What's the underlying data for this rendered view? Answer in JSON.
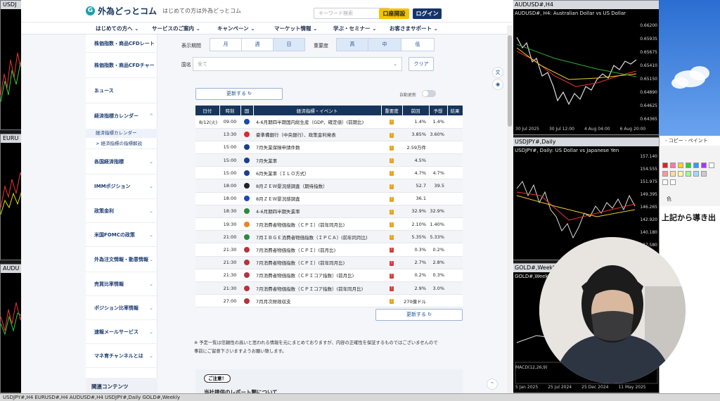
{
  "site": {
    "logo": "外為どっとコム",
    "tagline": "はじめての方は外為どっとコム",
    "search_placeholder": "キーワード検索",
    "open_account": "口座開設",
    "login": "ログイン",
    "brand_color": "#16346a",
    "accent_color": "#f6c200"
  },
  "nav": [
    {
      "label": "はじめての方へ ⌄"
    },
    {
      "label": "サービスのご案内 ⌄"
    },
    {
      "label": "キャンペーン ⌄"
    },
    {
      "label": "マーケット情報 ⌄"
    },
    {
      "label": "学ぶ・セミナー ⌄"
    },
    {
      "label": "お客さまサポート ⌄"
    }
  ],
  "sidebar": {
    "items": [
      {
        "label": "株価指数・商品CFDレート"
      },
      {
        "label": "株価指数・商品CFDチャート"
      },
      {
        "label": "ニュース"
      },
      {
        "label": "経済指標カレンダー",
        "chev": "^"
      },
      {
        "label": "各国経済指標",
        "chev": "⌄"
      },
      {
        "label": "IMMポジション",
        "chev": "⌄"
      },
      {
        "label": "政策金利",
        "chev": "⌄"
      },
      {
        "label": "米国FOMCの政策",
        "chev": "⌄"
      },
      {
        "label": "外為注文情報・動意情報",
        "chev": "⌄"
      },
      {
        "label": "売買比率情報",
        "chev": "⌄"
      },
      {
        "label": "ポジション比率情報",
        "chev": "⌄"
      },
      {
        "label": "速報メールサービス",
        "chev": "⌄"
      },
      {
        "label": "マネ育チャンネルとは",
        "chev": "⌄"
      }
    ],
    "subitems": [
      {
        "label": "経済指標カレンダー"
      },
      {
        "label": "> 経済指標の指標解説"
      }
    ],
    "footer": "関連コンテンツ"
  },
  "filters": {
    "period_label": "表示期間",
    "period_options": [
      "月",
      "週",
      "日"
    ],
    "period_selected": "日",
    "importance_label": "重要度",
    "importance_options": [
      "高",
      "中",
      "低"
    ],
    "country_label": "国名",
    "country_value": "全て",
    "clear": "クリア",
    "refresh": "更新する ↻",
    "auto_update": "自動更新"
  },
  "table": {
    "headers": [
      "日付",
      "時刻",
      "国",
      "経済指標・イベント",
      "重要度",
      "前回",
      "予想",
      "結果"
    ],
    "rows": [
      {
        "date": "8/12(火)",
        "time": "09:00",
        "flag": "#1b4aa8",
        "event": "4-6月期四半期国内総生産（GDP、確定値）(前期比)",
        "imp": "!",
        "imp_level": "mid",
        "prev": "1.4%",
        "fcst": "1.4%",
        "res": ""
      },
      {
        "date": "",
        "time": "13:30",
        "flag": "#d92c2c",
        "event": "豪準備銀行（中央銀行）、政策金利発表",
        "imp": "!",
        "imp_level": "mid",
        "prev": "3.85%",
        "fcst": "3.60%",
        "res": ""
      },
      {
        "date": "",
        "time": "15:00",
        "flag": "#1b3f8e",
        "event": "7月失業保険申請件数",
        "imp": "!",
        "imp_level": "mid",
        "prev": "2.59万件",
        "fcst": "",
        "res": ""
      },
      {
        "date": "",
        "time": "15:00",
        "flag": "#1b3f8e",
        "event": "7月失業率",
        "imp": "!",
        "imp_level": "mid",
        "prev": "4.5%",
        "fcst": "",
        "res": ""
      },
      {
        "date": "",
        "time": "15:00",
        "flag": "#1b3f8e",
        "event": "6月失業率（ＩＬＯ方式）",
        "imp": "!",
        "imp_level": "mid",
        "prev": "4.7%",
        "fcst": "4.7%",
        "res": ""
      },
      {
        "date": "",
        "time": "18:00",
        "flag": "#222222",
        "event": "8月ＺＥＷ景況感調査（期待指数）",
        "imp": "!",
        "imp_level": "mid",
        "prev": "52.7",
        "fcst": "39.5",
        "res": ""
      },
      {
        "date": "",
        "time": "18:00",
        "flag": "#1b4aa8",
        "event": "8月ＺＥＷ景況感調査",
        "imp": "!",
        "imp_level": "mid",
        "prev": "36.1",
        "fcst": "",
        "res": ""
      },
      {
        "date": "",
        "time": "18:30",
        "flag": "#2a8a3e",
        "event": "4-6月期四半期失業率",
        "imp": "!",
        "imp_level": "mid",
        "prev": "32.9%",
        "fcst": "32.9%",
        "res": ""
      },
      {
        "date": "",
        "time": "19:30",
        "flag": "#e8862a",
        "event": "7月消費者物価指数（ＣＰＩ）(前年同月比)",
        "imp": "!",
        "imp_level": "mid",
        "prev": "2.10%",
        "fcst": "1.40%",
        "res": ""
      },
      {
        "date": "",
        "time": "21:00",
        "flag": "#2a8a3e",
        "event": "7月ＩＢＧＥ消費者物価指数（ＩＰＣＡ）(前年同月比)",
        "imp": "!",
        "imp_level": "mid",
        "prev": "5.35%",
        "fcst": "5.33%",
        "res": ""
      },
      {
        "date": "",
        "time": "21:30",
        "flag": "#b5333e",
        "event": "7月消費者物価指数（ＣＰＩ）(前月比)",
        "imp": "!",
        "imp_level": "high",
        "prev": "0.3%",
        "fcst": "0.2%",
        "res": ""
      },
      {
        "date": "",
        "time": "21:30",
        "flag": "#b5333e",
        "event": "7月消費者物価指数（ＣＰＩ）(前年同月比)",
        "imp": "!",
        "imp_level": "high",
        "prev": "2.7%",
        "fcst": "2.8%",
        "res": ""
      },
      {
        "date": "",
        "time": "21:30",
        "flag": "#b5333e",
        "event": "7月消費者物価指数（ＣＰＩコア指数）(前月比)",
        "imp": "!",
        "imp_level": "high",
        "prev": "0.2%",
        "fcst": "0.3%",
        "res": ""
      },
      {
        "date": "",
        "time": "21:30",
        "flag": "#b5333e",
        "event": "7月消費者物価指数（ＣＰＩコア指数）(前年同月比)",
        "imp": "!",
        "imp_level": "high",
        "prev": "2.9%",
        "fcst": "3.0%",
        "res": ""
      },
      {
        "date": "",
        "time": "27:00",
        "flag": "#b5333e",
        "event": "7月月次財政収支",
        "imp": "!",
        "imp_level": "mid",
        "prev": "270億ドル",
        "fcst": "",
        "res": ""
      }
    ]
  },
  "footnote": "※ 予定一覧は信頼性の高いと思われる情報を元にまとめておりますが、内容の正確性を保証するものではございませんので事前にご留意下さいますようお願い致します。",
  "notice": {
    "badge": "ご注意！",
    "title": "当社提供のレポート類について"
  },
  "charts": {
    "audusd": {
      "title": "AUDUSD#,H4",
      "symbol": "AUDUSD#, H4:  Australian Dollar vs US Dollar",
      "prices": [
        "0.66200",
        "0.65935",
        "0.65675",
        "0.65410",
        "0.65150",
        "0.64890",
        "0.64625",
        "0.64365",
        "0.64105"
      ],
      "dates": [
        "30 Jul 2025",
        "30 Jul 12:00",
        "4 Aug 04:00",
        "6 Aug 20:00"
      ]
    },
    "usdjpy": {
      "title": "USDJPY#,Daily",
      "symbol": "USDJPY#, Daily:  US Dollar vs Japanese Yen",
      "prices": [
        "157.140",
        "154.555",
        "151.975",
        "149.395",
        "146.265",
        "142.920",
        "140.180",
        "137.580"
      ]
    },
    "gold": {
      "title": "GOLD#,Weekly",
      "symbol": "GOLD#,Weekly",
      "dates": [
        "5 Jan 2025",
        "25 Jul 2024",
        "25 Dec 2024",
        "11 May 2025"
      ],
      "macd_label": "MACD(12,26,9)"
    }
  },
  "left_windows": [
    {
      "title": "USDJ"
    },
    {
      "title": "EURU"
    },
    {
      "title": "AUDU"
    }
  ],
  "paint": {
    "title": "- コピー - ペイント",
    "color_label": "色",
    "text": "上記から導き出"
  },
  "taskbar": "USDJPY#,H4      EURUSD#,H4      AUDUSD#,H4      USDJPY#,Daily      GOLD#,Weekly"
}
